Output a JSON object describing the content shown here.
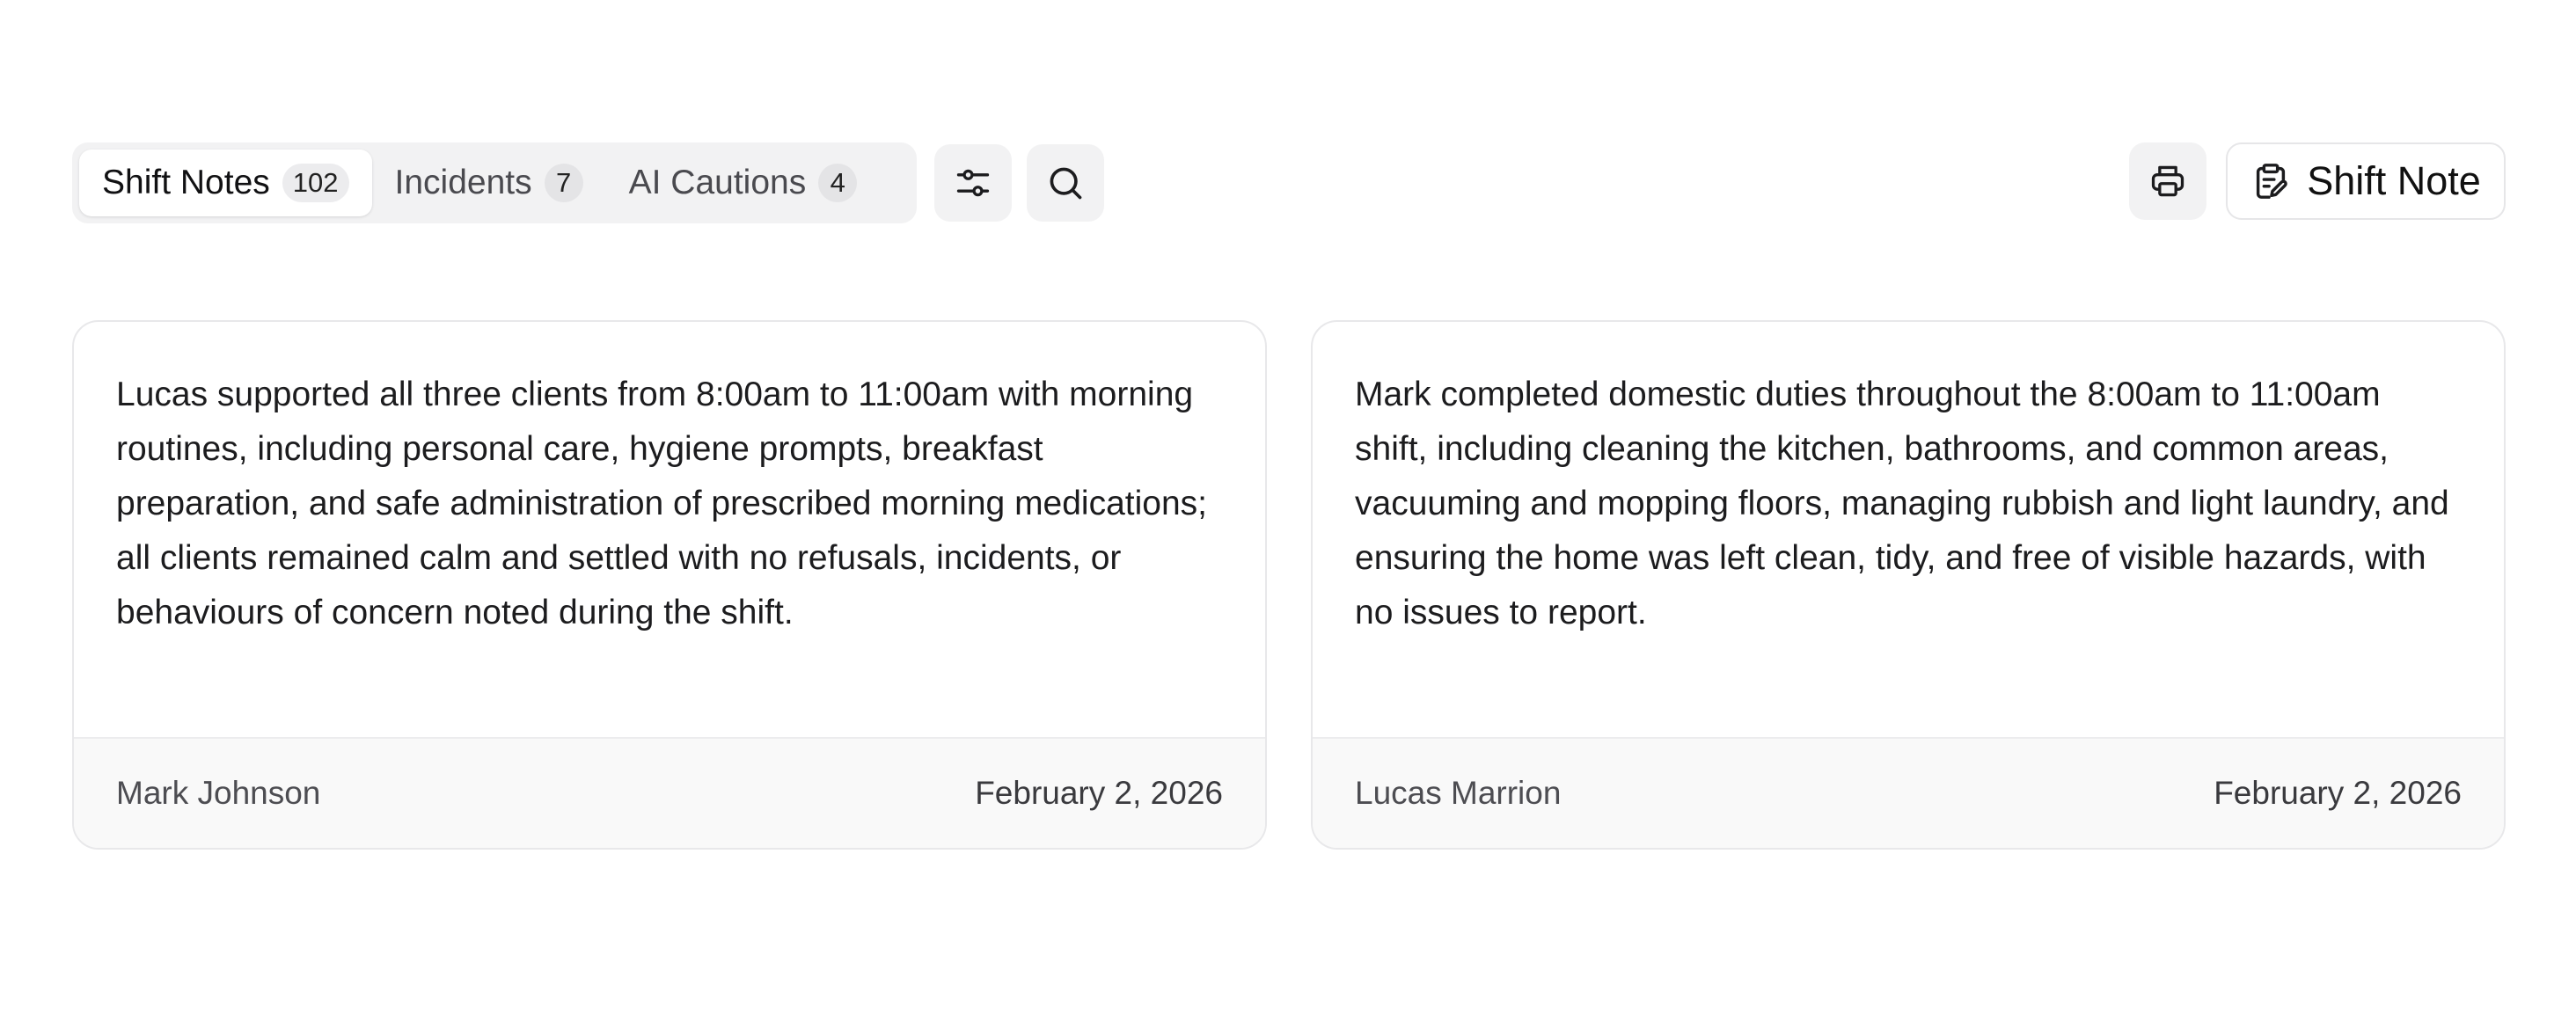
{
  "tabs": [
    {
      "label": "Shift Notes",
      "count": "102"
    },
    {
      "label": "Incidents",
      "count": "7"
    },
    {
      "label": "AI Cautions",
      "count": "4"
    }
  ],
  "toolbar": {
    "filter_icon": "sliders-icon",
    "search_icon": "search-icon",
    "print_icon": "printer-icon",
    "new_note_icon": "clipboard-edit-icon",
    "new_note_label": "Shift Note"
  },
  "notes": [
    {
      "text": "Lucas supported all three clients from 8:00am to 11:00am with morning routines, including personal care, hygiene prompts, breakfast preparation, and safe administration of prescribed morning medications; all clients remained calm and settled with no refusals, incidents, or behaviours of concern noted during the shift.",
      "author": "Mark Johnson",
      "date": "February 2, 2026"
    },
    {
      "text": "Mark completed domestic duties throughout the 8:00am to 11:00am shift, including cleaning the kitchen, bathrooms, and common areas, vacuuming and mopping floors, managing rubbish and light laundry, and ensuring the home was left clean, tidy, and free of visible hazards, with no issues to report.",
      "author": "Lucas Marrion",
      "date": "February 2, 2026"
    }
  ]
}
